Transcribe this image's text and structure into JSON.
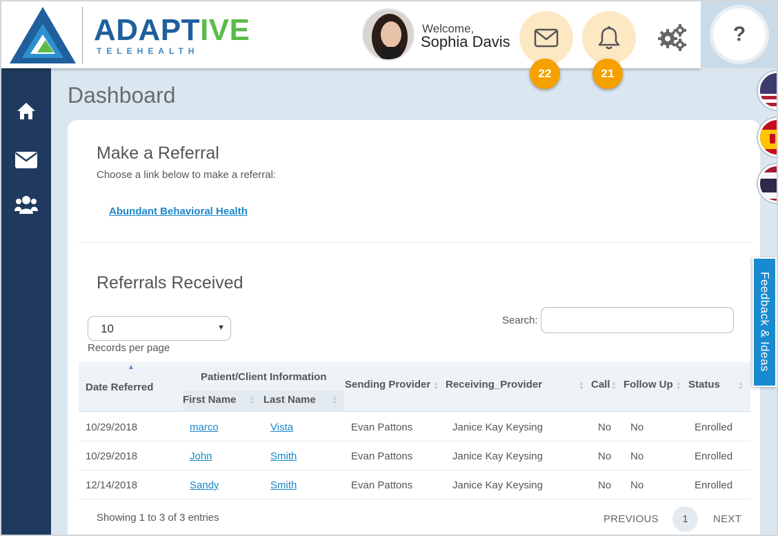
{
  "brand": {
    "name_part1": "ADAPT",
    "name_part2": "IVE",
    "subtitle": "TELEHEALTH"
  },
  "header": {
    "welcome": "Welcome,",
    "username": "Sophia Davis",
    "messages_count": "22",
    "notifications_count": "21",
    "help_label": "?"
  },
  "sidebar": {
    "items": [
      "home-icon",
      "mail-icon",
      "users-icon"
    ]
  },
  "page": {
    "title": "Dashboard"
  },
  "referral": {
    "title": "Make a Referral",
    "subtitle": "Choose a link below to make a referral:",
    "link": "Abundant Behavioral Health"
  },
  "received": {
    "title": "Referrals Received",
    "page_size": "10",
    "records_label": "Records per page",
    "search_label": "Search:",
    "search_value": ""
  },
  "table": {
    "headers": {
      "date": "Date Referred",
      "patient_group": "Patient/Client Information",
      "first": "First Name",
      "last": "Last Name",
      "sending": "Sending Provider",
      "receiving": "Receiving_Provider",
      "call": "Call",
      "follow": "Follow Up",
      "status": "Status"
    },
    "rows": [
      {
        "date": "10/29/2018",
        "first": "marco",
        "last": "Vista",
        "sending": "Evan Pattons",
        "receiving": "Janice Kay Keysing",
        "call": "No",
        "follow": "No",
        "status": "Enrolled"
      },
      {
        "date": "10/29/2018",
        "first": "John",
        "last": "Smith",
        "sending": "Evan Pattons",
        "receiving": "Janice Kay Keysing",
        "call": "No",
        "follow": "No",
        "status": "Enrolled"
      },
      {
        "date": "12/14/2018",
        "first": "Sandy",
        "last": "Smith",
        "sending": "Evan Pattons",
        "receiving": "Janice Kay Keysing",
        "call": "No",
        "follow": "No",
        "status": "Enrolled"
      }
    ]
  },
  "pagination": {
    "summary": "Showing 1 to 3 of 3 entries",
    "previous": "PREVIOUS",
    "current": "1",
    "next": "NEXT"
  },
  "feedback": {
    "label": "Feedback & Ideas"
  },
  "languages": [
    "us-flag-icon",
    "spain-flag-icon",
    "thailand-flag-icon"
  ],
  "colors": {
    "sidebar": "#1f3a5e",
    "accent": "#1a87c9",
    "badge": "#f6a000",
    "brand_blue": "#1f5f9c",
    "brand_green": "#5cbb4a"
  }
}
